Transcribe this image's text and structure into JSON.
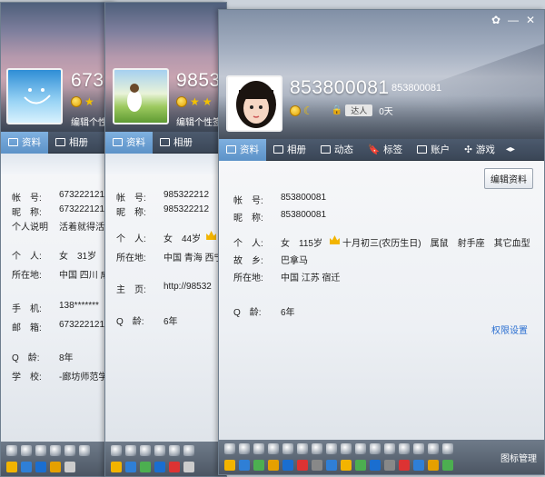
{
  "windows": [
    {
      "id": "w1",
      "uid": "6732",
      "signature": "编辑个性",
      "tabs": [
        "资料",
        "相册"
      ],
      "fields": [
        {
          "k": "帐　号:",
          "v": "673222121"
        },
        {
          "k": "昵　称:",
          "v": "673222121"
        },
        {
          "k": "个人说明",
          "v": "活着就得活出"
        },
        {
          "k": "个　人:",
          "v": "女　31岁"
        },
        {
          "k": "所在地:",
          "v": "中国 四川 成"
        },
        {
          "k": "手　机:",
          "v": "138*******"
        },
        {
          "k": "邮　箱:",
          "v": "673222121"
        },
        {
          "k": "Q　龄:",
          "v": "8年"
        },
        {
          "k": "学　校:",
          "v": "-廊坊师范学"
        }
      ]
    },
    {
      "id": "w2",
      "uid": "98532",
      "signature": "编辑个性签",
      "tabs": [
        "资料",
        "相册"
      ],
      "fields": [
        {
          "k": "帐　号:",
          "v": "985322212"
        },
        {
          "k": "昵　称:",
          "v": "985322212"
        },
        {
          "k": "个　人:",
          "v": "女　44岁"
        },
        {
          "k": "所在地:",
          "v": "中国 青海 西宁"
        },
        {
          "k": "主　页:",
          "v": "http://98532"
        },
        {
          "k": "Q　龄:",
          "v": "6年"
        }
      ]
    },
    {
      "id": "w3",
      "uid": "853800081",
      "uid_small": "853800081",
      "level_text": "0天",
      "status": "达人",
      "tabs": [
        "资料",
        "相册",
        "动态",
        "标签",
        "账户",
        "游戏"
      ],
      "edit_button": "编辑资料",
      "perm_link": "权限设置",
      "fields": [
        {
          "k": "帐　号:",
          "v": "853800081"
        },
        {
          "k": "昵　称:",
          "v": "853800081"
        },
        {
          "k": "个　人:",
          "v": "女　115岁"
        },
        {
          "k": "",
          "v": "十月初三(农历生日)　属鼠　射手座　其它血型"
        },
        {
          "k": "故　乡:",
          "v": "巴拿马"
        },
        {
          "k": "所在地:",
          "v": "中国 江苏 宿迁"
        },
        {
          "k": "Q　龄:",
          "v": "6年"
        }
      ],
      "bottom_label": "图标管理"
    }
  ],
  "colors": {
    "accent": "#5c92c8",
    "link": "#2a6fd1"
  }
}
